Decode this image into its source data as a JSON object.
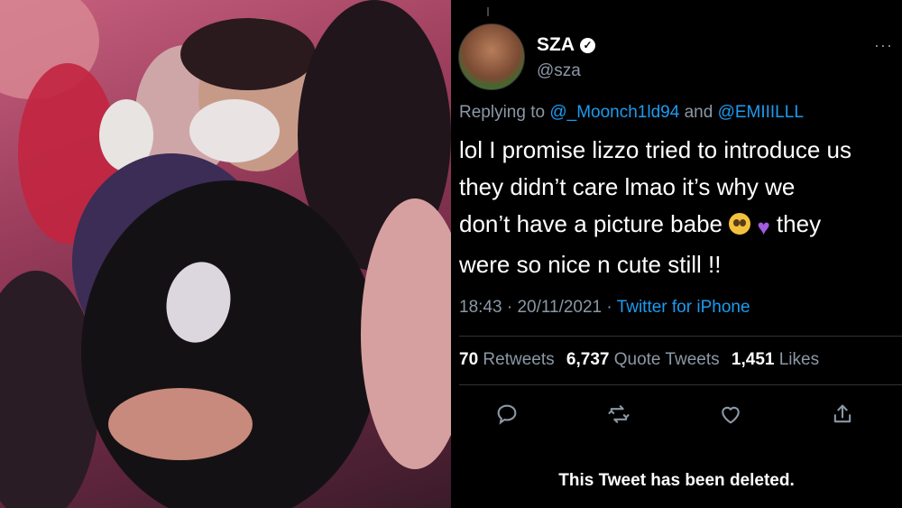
{
  "photo": {
    "description_icon": "concert-crowd-photo"
  },
  "tweet": {
    "author": {
      "name": "SZA",
      "handle": "@sza",
      "verified_icon": "verified-badge-icon"
    },
    "more_label": "···",
    "reply": {
      "prefix": "Replying to ",
      "mention_1": "@_Moonch1ld94",
      "connector": " and ",
      "mention_2": "@EMIIILLL"
    },
    "body": {
      "line1": "lol I promise lizzo tried to introduce us",
      "line2": "they didn’t care lmao it’s why we",
      "line3_text": "don’t have a picture babe ",
      "line3_tail": " they",
      "line4": "were so nice n cute still !!"
    },
    "meta": {
      "time": "18:43",
      "sep1": " · ",
      "date": "20/11/2021",
      "sep2": " · ",
      "client": "Twitter for iPhone"
    },
    "stats": {
      "retweets_count": "70",
      "retweets_label": " Retweets",
      "quotes_count": "6,737",
      "quotes_label": " Quote Tweets",
      "likes_count": "1,451",
      "likes_label": " Likes"
    },
    "deleted_notice": "This Tweet has been deleted.",
    "colors": {
      "link": "#1d9bf0",
      "secondary_text": "#8b98a5",
      "background": "#000000"
    }
  }
}
